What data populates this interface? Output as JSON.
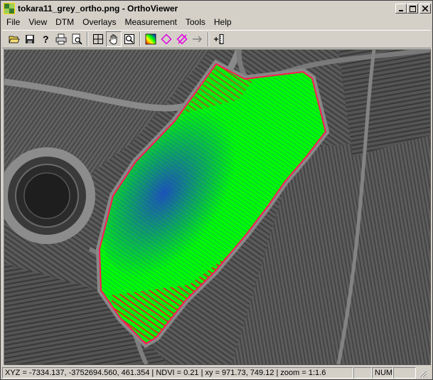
{
  "window": {
    "title": "tokara11_grey_ortho.png - OrthoViewer"
  },
  "title_buttons": {
    "minimize": "_",
    "maximize": "□",
    "close": "×"
  },
  "menu": [
    "File",
    "View",
    "DTM",
    "Overlays",
    "Measurement",
    "Tools",
    "Help"
  ],
  "toolbar": {
    "tools": [
      "open-folder-icon",
      "save-icon",
      "help-icon",
      "print-icon",
      "print-preview-icon",
      "fit-extent-icon",
      "pan-hand-icon",
      "zoom-icon",
      "ndvi-overlay-icon",
      "diamond-marker-icon",
      "erase-marker-icon",
      "measure-line-icon",
      "add-point-icon"
    ]
  },
  "overlay": {
    "colors": {
      "high": "#1f36d6",
      "mid": "#00ff00",
      "low": "#e81a1a",
      "outline": "#ff1a52"
    }
  },
  "status": {
    "coords": "XYZ = -7334.137, -3752694.560, 461.354  |  NDVI = 0.21  |  xy = 971.73, 749.12  |  zoom = 1:1.6",
    "pane2": "",
    "num": "NUM",
    "pane4": ""
  }
}
